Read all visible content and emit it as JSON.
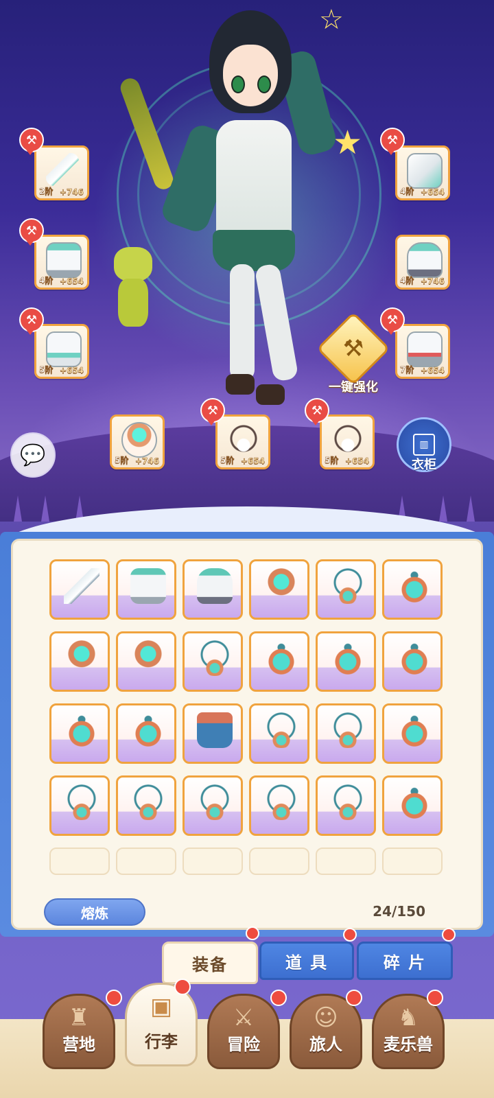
{
  "equipment_slots": [
    {
      "id": "weapon",
      "tier": "2阶",
      "bonus": "+746",
      "icon": "blade-gear-icon"
    },
    {
      "id": "helmet",
      "tier": "4阶",
      "bonus": "+654",
      "icon": "helmet-gear-icon"
    },
    {
      "id": "armor",
      "tier": "4阶",
      "bonus": "+654",
      "icon": "armor-gear-icon"
    },
    {
      "id": "gloves",
      "tier": "4阶",
      "bonus": "+746",
      "icon": "glove-gear-icon"
    },
    {
      "id": "belt",
      "tier": "5阶",
      "bonus": "+654",
      "icon": "belt-gear-icon"
    },
    {
      "id": "boots",
      "tier": "7阶",
      "bonus": "+654",
      "icon": "boots-gear-icon"
    },
    {
      "id": "ring",
      "tier": "5阶",
      "bonus": "+746",
      "icon": "ring-gear-icon"
    },
    {
      "id": "necklace1",
      "tier": "5阶",
      "bonus": "+654",
      "icon": "necklace-gear-icon"
    },
    {
      "id": "necklace2",
      "tier": "5阶",
      "bonus": "+654",
      "icon": "necklace-gear-icon"
    }
  ],
  "enhance": {
    "label": "一键强化",
    "icon": "hammer-up-icon"
  },
  "wardrobe": {
    "label": "衣柜",
    "icon": "wardrobe-icon"
  },
  "chat": {
    "icon": "chat-bubble-icon"
  },
  "inventory": {
    "items": [
      "blade",
      "armor",
      "glove",
      "ring",
      "necklace",
      "amulet",
      "ring",
      "ring",
      "necklace",
      "amulet",
      "amulet",
      "amulet",
      "amulet",
      "amulet",
      "pants",
      "necklace",
      "necklace",
      "amulet",
      "necklace",
      "necklace",
      "necklace",
      "necklace",
      "necklace",
      "amulet"
    ],
    "empty_slots": 6,
    "smelt_label": "熔炼",
    "capacity": "24/150"
  },
  "tabs": [
    {
      "label": "装备",
      "active": true
    },
    {
      "label": "道 具",
      "active": false
    },
    {
      "label": "碎 片",
      "active": false
    }
  ],
  "nav": [
    {
      "label": "营地",
      "icon": "castle-icon",
      "active": false
    },
    {
      "label": "行李",
      "icon": "chest-icon",
      "active": true
    },
    {
      "label": "冒险",
      "icon": "crossed-swords-icon",
      "active": false
    },
    {
      "label": "旅人",
      "icon": "traveler-icon",
      "active": false
    },
    {
      "label": "麦乐兽",
      "icon": "pet-icon",
      "active": false
    }
  ],
  "colors": {
    "accent": "#f0a33e",
    "badge": "#ee4c3f",
    "tab_blue": "#3d6fd0"
  }
}
